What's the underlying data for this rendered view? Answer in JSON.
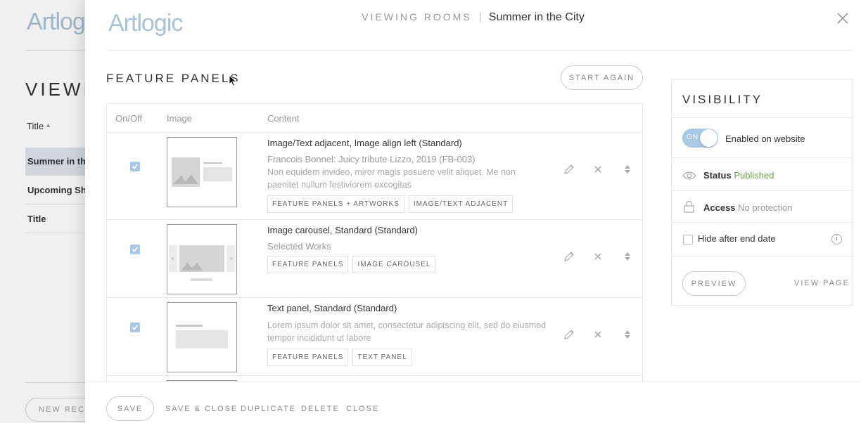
{
  "background": {
    "logo": "Artlogic",
    "heading": "VIEWING",
    "column_title": "Title",
    "rows": [
      "Summer in the",
      "Upcoming Sho",
      "Title"
    ],
    "new_record": "NEW RECORD"
  },
  "header": {
    "logo": "Artlogic",
    "section": "VIEWING ROOMS",
    "separator": "|",
    "current": "Summer in the City"
  },
  "feature_panels": {
    "title": "FEATURE PANELS",
    "start_again": "START AGAIN",
    "columns": {
      "onoff": "On/Off",
      "image": "Image",
      "content": "Content"
    },
    "rows": [
      {
        "checked": true,
        "title": "Image/Text adjacent, Image align left (Standard)",
        "subtitle": "Francois Bonnel: Juicy tribute Lizzo, 2019 (FB-003)",
        "description": "Non equidem invideo, miror magis posuere velit aliquet. Me non paenitet nullum festiviorem excogitas",
        "tags": [
          "FEATURE PANELS + ARTWORKS",
          "IMAGE/TEXT ADJACENT"
        ]
      },
      {
        "checked": true,
        "title": "Image carousel, Standard (Standard)",
        "subtitle": "Selected Works",
        "description": "",
        "tags": [
          "FEATURE PANELS",
          "IMAGE CAROUSEL"
        ]
      },
      {
        "checked": true,
        "title": "Text panel, Standard (Standard)",
        "subtitle": "",
        "description": "Lorem ipsum dolor sit amet, consectetur adipiscing elit, sed do eiusmod tempor incididunt ut labore",
        "tags": [
          "FEATURE PANELS",
          "TEXT PANEL"
        ]
      }
    ]
  },
  "visibility": {
    "title": "VISIBILITY",
    "toggle_label": "ON",
    "enabled_label": "Enabled on website",
    "status_label": "Status",
    "status_value": "Published",
    "access_label": "Access",
    "access_value": "No protection",
    "hide_after_end": "Hide after end date",
    "preview": "PREVIEW",
    "view_page": "VIEW PAGE"
  },
  "footer": {
    "save": "SAVE",
    "save_close": "SAVE & CLOSE",
    "duplicate": "DUPLICATE",
    "delete": "DELETE",
    "close": "CLOSE"
  },
  "colors": {
    "accent": "#a9c8e6",
    "logo": "#a9c2d6",
    "published": "#6aa14a"
  }
}
